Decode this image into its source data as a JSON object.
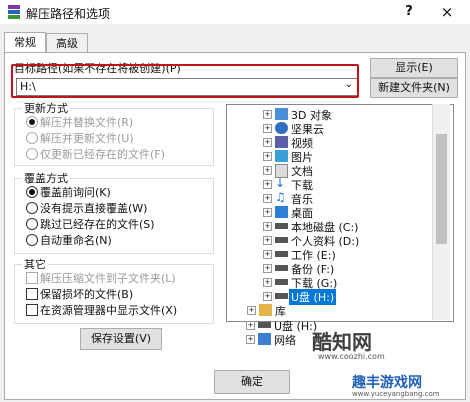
{
  "title": "解压路径和选项",
  "help_label": "?",
  "close_label": "×",
  "tabs": [
    {
      "label": "常规"
    },
    {
      "label": "高级"
    }
  ],
  "target": {
    "label": "目标路径(如果不存在将被创建)(P)",
    "value": "H:\\",
    "show_label": "显示(E)",
    "new_folder_label": "新建文件夹(N)"
  },
  "update_mode": {
    "title": "更新方式",
    "options": [
      {
        "label": "解压并替换文件(R)",
        "checked": true
      },
      {
        "label": "解压并更新文件(U)",
        "checked": false
      },
      {
        "label": "仅更新已经存在的文件(F)",
        "checked": false
      }
    ]
  },
  "overwrite_mode": {
    "title": "覆盖方式",
    "options": [
      {
        "label": "覆盖前询问(K)",
        "checked": true
      },
      {
        "label": "没有提示直接覆盖(W)",
        "checked": false
      },
      {
        "label": "跳过已经存在的文件(S)",
        "checked": false
      },
      {
        "label": "自动重命名(N)",
        "checked": false
      }
    ]
  },
  "other": {
    "title": "其它",
    "options": [
      {
        "label": "解压压缩文件到子文件夹(L)",
        "checked": false
      },
      {
        "label": "保留损坏的文件(B)",
        "checked": false
      },
      {
        "label": "在资源管理器中显示文件(X)",
        "checked": false
      }
    ]
  },
  "save_settings_label": "保存设置(V)",
  "tree": {
    "items": [
      {
        "label": "3D 对象",
        "icon": "3d-objects-icon"
      },
      {
        "label": "坚果云",
        "icon": "cloud-folder-icon"
      },
      {
        "label": "视频",
        "icon": "video-folder-icon"
      },
      {
        "label": "图片",
        "icon": "pictures-folder-icon"
      },
      {
        "label": "文档",
        "icon": "documents-folder-icon"
      },
      {
        "label": "下载",
        "icon": "downloads-folder-icon"
      },
      {
        "label": "音乐",
        "icon": "music-folder-icon"
      },
      {
        "label": "桌面",
        "icon": "desktop-folder-icon"
      },
      {
        "label": "本地磁盘 (C:)",
        "icon": "drive-icon"
      },
      {
        "label": "个人资料 (D:)",
        "icon": "drive-icon"
      },
      {
        "label": "工作 (E:)",
        "icon": "drive-icon"
      },
      {
        "label": "备份 (F:)",
        "icon": "drive-icon"
      },
      {
        "label": "下载 (G:)",
        "icon": "drive-icon"
      },
      {
        "label": "U盘 (H:)",
        "icon": "usb-drive-icon"
      },
      {
        "label": "库",
        "icon": "library-icon"
      },
      {
        "label": "U盘 (H:)",
        "icon": "usb-drive-icon"
      },
      {
        "label": "网络",
        "icon": "network-icon"
      }
    ]
  },
  "ok_label": "确定",
  "watermarks": {
    "brand": "酷知网",
    "site": "www.coozhi.com",
    "brand2": "趣丰游戏网",
    "site2": "www.yuceyangbang.com"
  }
}
